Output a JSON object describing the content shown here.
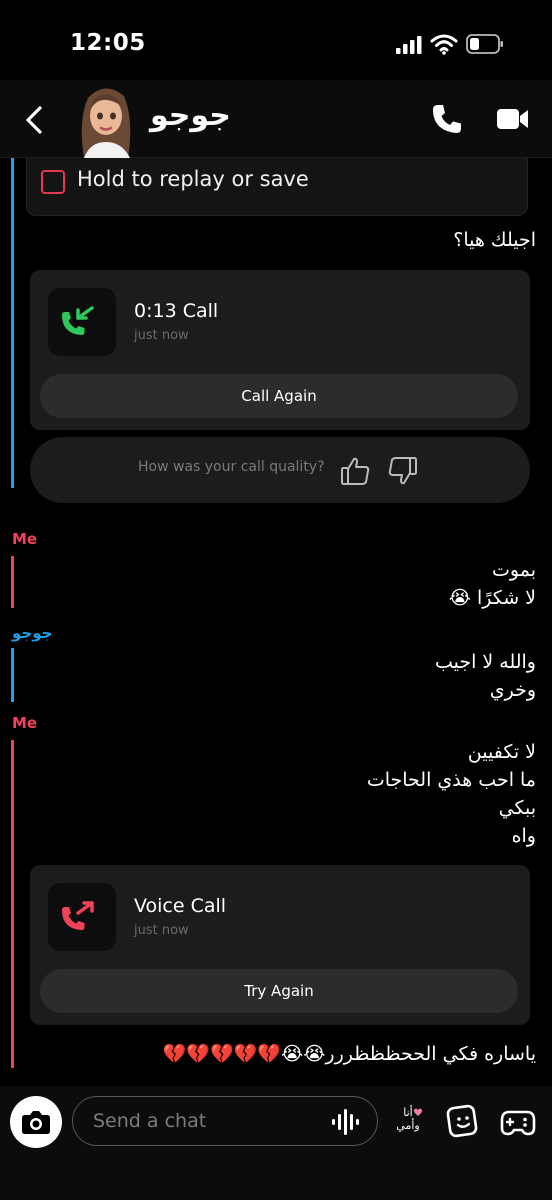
{
  "status_bar": {
    "time": "12:05"
  },
  "header": {
    "contact_name": "جوجو",
    "icons": [
      "back-icon",
      "avatar",
      "phone-icon",
      "video-icon"
    ]
  },
  "chat": {
    "snap_save": {
      "label": "Hold to replay or save"
    },
    "messages": [
      {
        "text": "اجيلك هيا؟"
      }
    ],
    "call_1": {
      "title": "0:13 Call",
      "time": "just now",
      "button": "Call Again",
      "icon_color": "#2fc85a"
    },
    "quality": {
      "question": "How was your call quality?"
    },
    "group_me_1": {
      "sender": "Me",
      "lines": [
        "بموت",
        "لا شكرًا 😭"
      ]
    },
    "group_jojo": {
      "sender": "جوجو",
      "lines": [
        "والله لا اجيب",
        "وخري"
      ]
    },
    "group_me_2": {
      "sender": "Me",
      "lines": [
        "لا تكفيين",
        "ما احب هذي الحاجات",
        "ببكي",
        "واه"
      ]
    },
    "call_2": {
      "title": "Voice Call",
      "time": "just now",
      "button": "Try Again",
      "icon_color": "#f0435a"
    },
    "last_message": "ياساره فكي الححظظظررر😭😭💔💔💔💔💔"
  },
  "bottom_bar": {
    "input_placeholder": "Send a chat",
    "sticker_text": "أنا وأمي"
  },
  "colors": {
    "me": "#f0435a",
    "friend": "#1aa3e8",
    "background": "#000000"
  }
}
